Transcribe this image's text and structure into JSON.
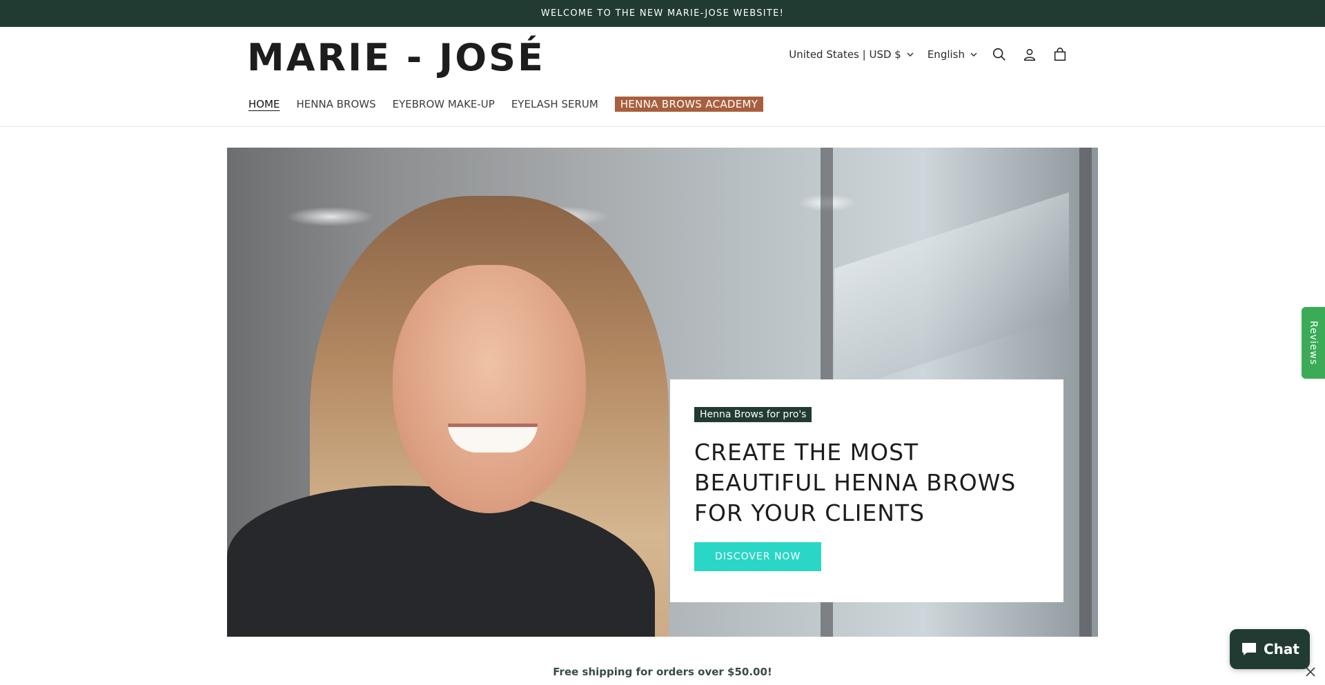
{
  "announcement": {
    "text": "WELCOME TO THE NEW MARIE-JOSE WEBSITE!"
  },
  "header": {
    "logo": "MARIE - JOSÉ",
    "country_selector": "United States | USD $",
    "language_selector": "English",
    "icons": [
      "search-icon",
      "account-icon",
      "cart-icon"
    ]
  },
  "nav": {
    "items": [
      {
        "label": "HOME",
        "active": true
      },
      {
        "label": "HENNA BROWS"
      },
      {
        "label": "EYEBROW MAKE-UP"
      },
      {
        "label": "EYELASH SERUM"
      },
      {
        "label": "HENNA BROWS ACADEMY",
        "highlight": true
      }
    ]
  },
  "hero": {
    "badge": "Henna Brows for pro's",
    "title": "CREATE THE MOST BEAUTIFUL HENNA BROWS FOR YOUR CLIENTS",
    "cta": "DISCOVER NOW"
  },
  "reviews_tab": {
    "label": "Reviews"
  },
  "shipping_bar": {
    "text": "Free shipping for orders over $50.00!"
  },
  "chat": {
    "label": "Chat"
  },
  "colors": {
    "announcement_bg": "#213b33",
    "academy_highlight": "#a85f3d",
    "cta": "#2ad6c5",
    "reviews": "#3bab58"
  }
}
